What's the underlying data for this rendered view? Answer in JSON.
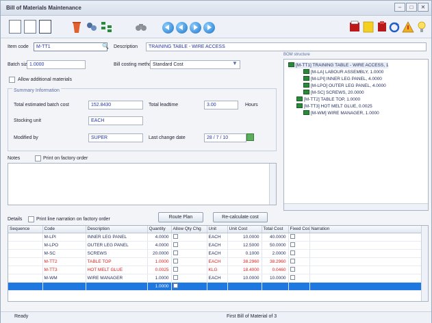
{
  "window": {
    "title": "Bill of Materials Maintenance"
  },
  "toolbar": {
    "icons": [
      "new-icon",
      "open-icon",
      "save-icon",
      "delete-icon",
      "calculate-icon",
      "structure-icon",
      "search-icon",
      "first-icon",
      "previous-icon",
      "next-icon",
      "last-icon",
      "print-icon",
      "notes-icon",
      "print-icon-2",
      "refresh-icon",
      "warning-icon",
      "help-icon"
    ]
  },
  "header": {
    "item_code_label": "Item code",
    "item_code_value": "M-TT1",
    "description_label": "Description",
    "description_value": "TRAINING TABLE - WIRE ACCESS",
    "batch_size_label": "Batch size",
    "batch_size_value": "1.0000",
    "costing_method_label": "Bill costing method",
    "costing_method_value": "Standard Cost",
    "allow_additional_label": "Allow additional materials"
  },
  "summary": {
    "title": "Summary Information",
    "total_cost_label": "Total estimated batch cost",
    "total_cost_value": "152.8430",
    "lead_time_label": "Total leadtime",
    "lead_time_value": "3.00",
    "lead_time_unit": "Hours",
    "stocking_unit_label": "Stocking unit",
    "stocking_unit_value": "EACH",
    "modified_by_label": "Modified by",
    "modified_by_value": "SUPER",
    "last_change_label": "Last change date",
    "last_change_value": "28 / 7 / 10"
  },
  "notes": {
    "label": "Notes",
    "print_label": "Print on factory order"
  },
  "details": {
    "label": "Details",
    "print_narration_label": "Print line narration on factory order",
    "route_plan_button": "Route Plan",
    "recalculate_button": "Re-calculate cost"
  },
  "tree": {
    "title": "BOM structure",
    "nodes": [
      "[M-TT1] TRAINING TABLE - WIRE ACCESS, 1",
      "[M-LA] LABOUR ASSEMBLY, 1.0000",
      "[M-LPI] INNER LEG PANEL, 4.0000",
      "[M-LPO] OUTER LEG PANEL, 4.0000",
      "[M-SC] SCREWS, 20.0000",
      "[M-TT2] TABLE TOP, 1.0000",
      "[M-TT3] HOT MELT GLUE, 0.0025",
      "[M-WM] WIRE MANAGER, 1.0000"
    ]
  },
  "grid": {
    "columns": [
      "Sequence",
      "Code",
      "Description",
      "Quantity",
      "Allow Qty Chg",
      "Unit",
      "Unit Cost",
      "Total Cost",
      "Fixed Cost",
      "Narration"
    ],
    "rows": [
      {
        "sequence": "",
        "code": "M-LPI",
        "description": "INNER LEG PANEL",
        "quantity": "4.0000",
        "unit": "EACH",
        "unit_cost": "10.0000",
        "total_cost": "40.0000",
        "color": "normal"
      },
      {
        "sequence": "",
        "code": "M-LPO",
        "description": "OUTER LEG PANEL",
        "quantity": "4.0000",
        "unit": "EACH",
        "unit_cost": "12.5000",
        "total_cost": "50.0000",
        "color": "normal"
      },
      {
        "sequence": "",
        "code": "M-SC",
        "description": "SCREWS",
        "quantity": "20.0000",
        "unit": "EACH",
        "unit_cost": "0.1000",
        "total_cost": "2.0000",
        "color": "normal"
      },
      {
        "sequence": "",
        "code": "M-TT2",
        "description": "TABLE TOP",
        "quantity": "1.0000",
        "unit": "EACH",
        "unit_cost": "38.2960",
        "total_cost": "38.2960",
        "color": "red"
      },
      {
        "sequence": "",
        "code": "M-TT3",
        "description": "HOT MELT GLUE",
        "quantity": "0.0025",
        "unit": "KLG",
        "unit_cost": "18.4000",
        "total_cost": "0.0460",
        "color": "red"
      },
      {
        "sequence": "",
        "code": "M-WM",
        "description": "WIRE MANAGER",
        "quantity": "1.0000",
        "unit": "EACH",
        "unit_cost": "10.0000",
        "total_cost": "10.0000",
        "color": "normal"
      },
      {
        "sequence": "",
        "code": "",
        "description": "",
        "quantity": "1.0000",
        "unit": "",
        "unit_cost": "",
        "total_cost": "",
        "color": "selected"
      }
    ]
  },
  "status": {
    "left": "Ready",
    "center": "First Bill of Material of 3"
  },
  "colors": {
    "accent": "#1e78e0",
    "red_row": "#e02020",
    "field_text": "#2335a8"
  }
}
